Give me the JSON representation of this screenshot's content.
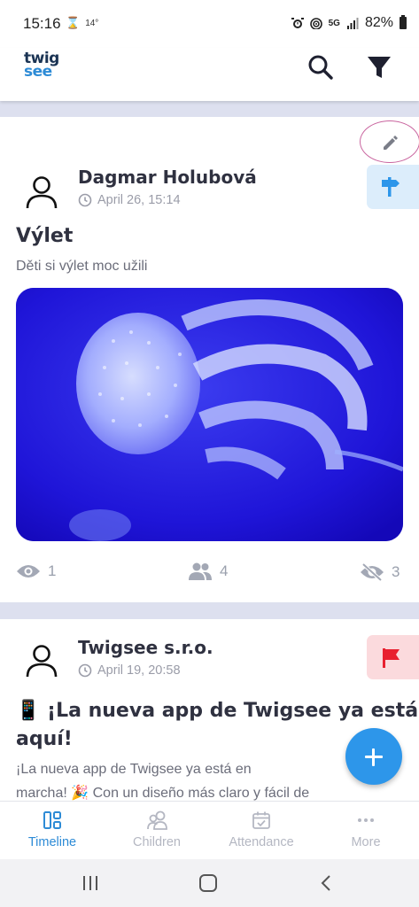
{
  "status_bar": {
    "time": "15:16",
    "temperature": "14°",
    "network": "5G",
    "battery": "82%"
  },
  "header": {
    "logo_line1": "twig",
    "logo_line2": "see",
    "search_icon": "search-icon",
    "filter_icon": "filter-icon"
  },
  "posts": [
    {
      "author": "Dagmar Holubová",
      "date": "April 26, 15:14",
      "title": "Výlet",
      "body": "Děti si výlet moc užili",
      "tag_icon": "signpost-icon",
      "image_subject": "jellyfish photo",
      "stats": {
        "views": "1",
        "recipients": "4",
        "unseen": "3"
      }
    },
    {
      "author": "Twigsee s.r.o.",
      "date": "April 19, 20:58",
      "title_line1": "📱 ¡La nueva app de Twigsee ya está",
      "title_line2": "aquí!",
      "body_line1": "¡La nueva app de Twigsee ya está en",
      "body_line2": "marcha! 🎉 Con un diseño más claro y fácil de",
      "tag_icon": "flag-icon"
    }
  ],
  "bottom_nav": [
    {
      "label": "Timeline",
      "icon": "timeline-icon",
      "active": true
    },
    {
      "label": "Children",
      "icon": "children-icon",
      "active": false
    },
    {
      "label": "Attendance",
      "icon": "calendar-check-icon",
      "active": false
    },
    {
      "label": "More",
      "icon": "more-dots-icon",
      "active": false
    }
  ],
  "colors": {
    "accent": "#2d8bd6",
    "fab": "#2d96ea",
    "feed_background": "#dde0ef",
    "tag_blue": "#dcedfb",
    "tag_red": "#fbdadd",
    "flag_red": "#e8202f"
  }
}
